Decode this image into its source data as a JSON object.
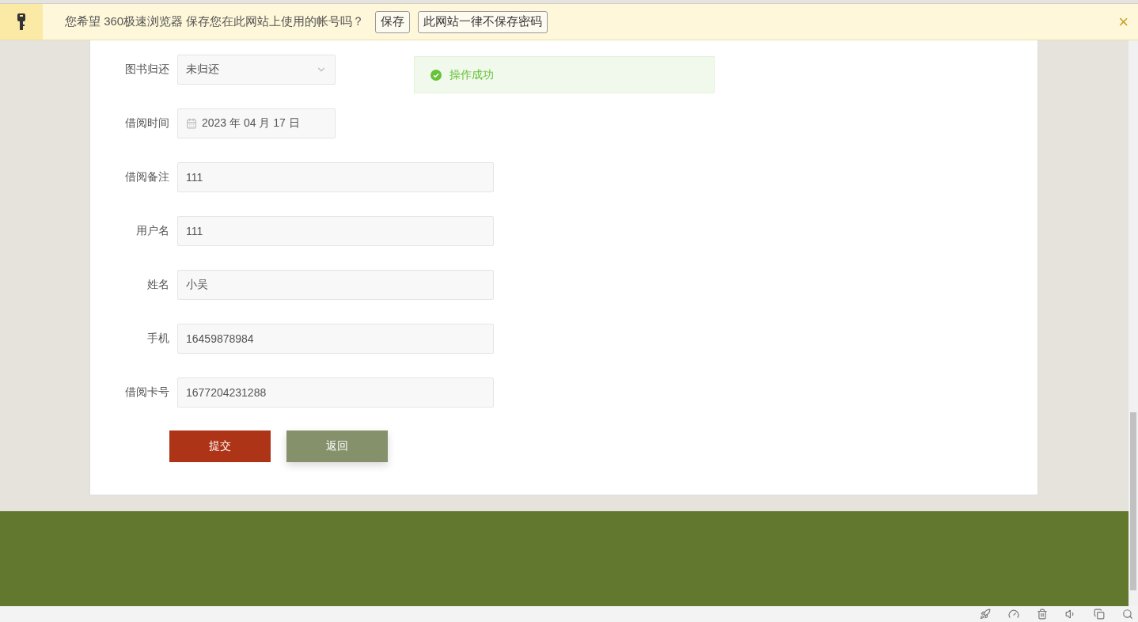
{
  "infobar": {
    "message": "您希望 360极速浏览器 保存您在此网站上使用的帐号吗？",
    "buttons": [
      "保存",
      "此网站一律不保存密码"
    ],
    "close": "×"
  },
  "form": {
    "fields": [
      {
        "label": "图书归还",
        "kind": "select",
        "value": "未归还"
      },
      {
        "label": "借阅时间",
        "kind": "date",
        "value": "2023 年 04 月 17 日"
      },
      {
        "label": "借阅备注",
        "kind": "text",
        "value": "111"
      },
      {
        "label": "用户名",
        "kind": "text",
        "value": "111"
      },
      {
        "label": "姓名",
        "kind": "text",
        "value": "小吴"
      },
      {
        "label": "手机",
        "kind": "text",
        "value": "16459878984"
      },
      {
        "label": "借阅卡号",
        "kind": "text",
        "value": "1677204231288"
      }
    ],
    "buttons": [
      {
        "label": "提交",
        "kind": "primary"
      },
      {
        "label": "返回",
        "kind": "secondary"
      }
    ]
  },
  "toast": {
    "message": "操作成功",
    "kind": "success"
  }
}
